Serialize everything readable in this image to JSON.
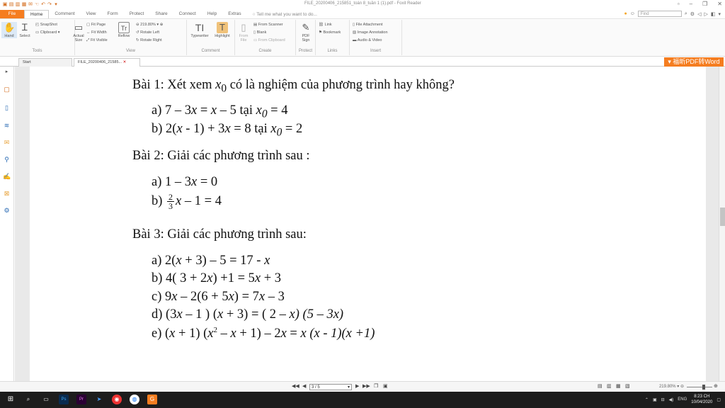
{
  "window": {
    "title": "FILE_20200406_215851_toán 8_tuần 1 (1).pdf - Foxit Reader"
  },
  "menu": {
    "file": "File",
    "tabs": [
      "Home",
      "Comment",
      "View",
      "Form",
      "Protect",
      "Share",
      "Connect",
      "Help",
      "Extras"
    ],
    "tell_me": "Tell me what you want to do...",
    "find_placeholder": "Find"
  },
  "ribbon": {
    "tools": {
      "label": "Tools",
      "hand": "Hand",
      "select": "Select",
      "snapshot": "SnapShot",
      "clipboard": "Clipboard"
    },
    "view": {
      "label": "View",
      "actual_size": "Actual Size",
      "fit_page": "Fit Page",
      "fit_width": "Fit Width",
      "fit_visible": "Fit Visible",
      "reflow": "Reflow",
      "zoom": "219.80%",
      "rotate_left": "Rotate Left",
      "rotate_right": "Rotate Right"
    },
    "comment": {
      "label": "Comment",
      "typewriter": "Typewriter",
      "highlight": "Highlight"
    },
    "create": {
      "label": "Create",
      "from_file": "From File",
      "from_scanner": "From Scanner",
      "blank": "Blank",
      "from_clipboard": "From Clipboard"
    },
    "protect": {
      "label": "Protect",
      "pdf_sign": "PDF Sign"
    },
    "links": {
      "label": "Links",
      "link": "Link",
      "bookmark": "Bookmark"
    },
    "insert": {
      "label": "Insert",
      "file_attachment": "File Attachment",
      "image_annotation": "Image Annotation",
      "audio_video": "Audio & Video"
    }
  },
  "tabs": {
    "start": "Start",
    "doc": "FILE_20200406_21585..."
  },
  "pdf_button": "福昕PDF转Word",
  "doc": {
    "b1": {
      "title": [
        "Bài 1: Xét xem ",
        "x",
        "0",
        " có là nghiệm của phương trình hay không?"
      ],
      "a": [
        "a)  7 – 3",
        "x",
        " = ",
        "x",
        " – 5 tại ",
        "x",
        "0",
        " = 4"
      ],
      "b": [
        "b)  2(",
        "x",
        " - 1) + 3",
        "x",
        " = 8 tại ",
        "x",
        "0",
        " = 2"
      ]
    },
    "b2": {
      "title": "Bài 2: Giải các phương trình sau :",
      "a": [
        "a)  1 – 3",
        "x",
        " = 0"
      ],
      "b": {
        "lbl": "b) ",
        "num": "2",
        "den": "3",
        "var": "x",
        "rest": " – 1 = 4"
      }
    },
    "b3": {
      "title": "Bài 3: Giải các phương trình sau:",
      "a": [
        "a)  2(",
        "x",
        " + 3) – 5 = 17 - ",
        "x"
      ],
      "b": [
        "b)  4( 3 + 2",
        "x",
        ") +1 = 5",
        "x",
        " + 3"
      ],
      "c": [
        "c)  9",
        "x",
        " – 2(6 + 5",
        "x",
        ") = 7",
        "x",
        " – 3"
      ],
      "d": [
        "d)  (3",
        "x",
        " – 1 ) (",
        "x",
        " + 3) = ( 2 – ",
        "x) (5 – 3x)"
      ],
      "e": [
        "e)  (",
        "x",
        " + 1) (",
        "x",
        "2",
        " – ",
        "x",
        " + 1) – 2",
        "x",
        " = ",
        "x (x - 1)(x +1)"
      ]
    }
  },
  "status": {
    "page": "3 / 5",
    "zoom": "219.80%"
  },
  "taskbar": {
    "time": "8:23 CH",
    "date": "10/04/2020",
    "lang": "ENG"
  }
}
